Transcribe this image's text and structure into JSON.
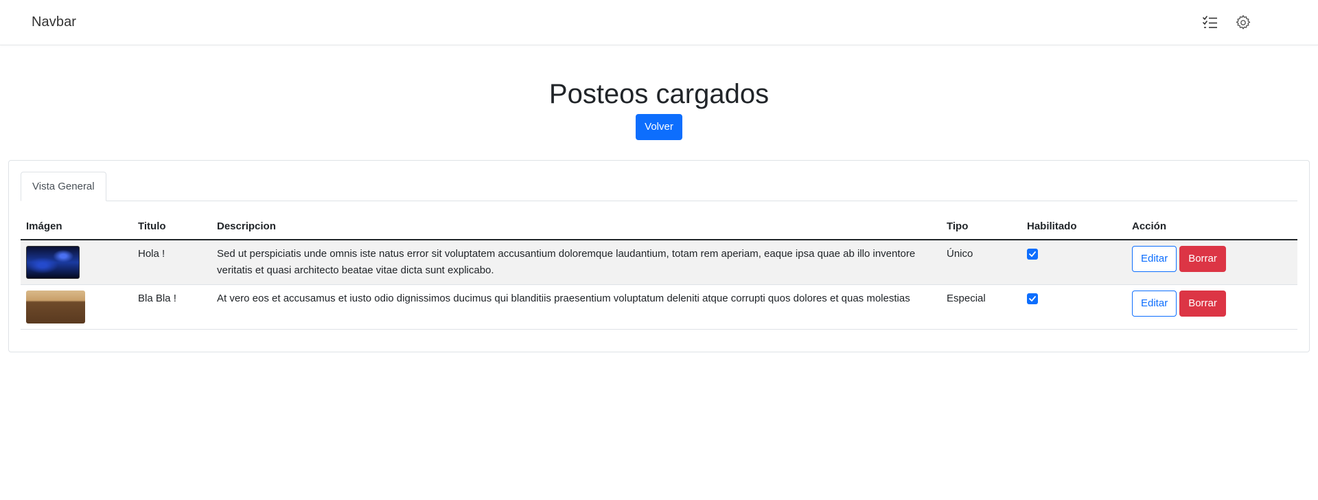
{
  "navbar": {
    "brand": "Navbar",
    "icons": [
      "checklist-icon",
      "gear-icon"
    ]
  },
  "header": {
    "title": "Posteos cargados",
    "back_label": "Volver"
  },
  "tabs": [
    {
      "label": "Vista General",
      "active": true
    }
  ],
  "table": {
    "columns": [
      "Imágen",
      "Titulo",
      "Descripcion",
      "Tipo",
      "Habilitado",
      "Acción"
    ],
    "rows": [
      {
        "image": "night-sky-thumbnail",
        "title": "Hola !",
        "description": "Sed ut perspiciatis unde omnis iste natus error sit voluptatem accusantium doloremque laudantium, totam rem aperiam, eaque ipsa quae ab illo inventore veritatis et quasi architecto beatae vitae dicta sunt explicabo.",
        "type": "Único",
        "enabled": true,
        "edit_label": "Editar",
        "delete_label": "Borrar"
      },
      {
        "image": "desert-thumbnail",
        "title": "Bla Bla !",
        "description": "At vero eos et accusamus et iusto odio dignissimos ducimus qui blanditiis praesentium voluptatum deleniti atque corrupti quos dolores et quas molestias",
        "type": "Especial",
        "enabled": true,
        "edit_label": "Editar",
        "delete_label": "Borrar"
      }
    ]
  },
  "colors": {
    "primary": "#0d6efd",
    "danger": "#dc3545",
    "stripe": "#f2f2f2"
  }
}
